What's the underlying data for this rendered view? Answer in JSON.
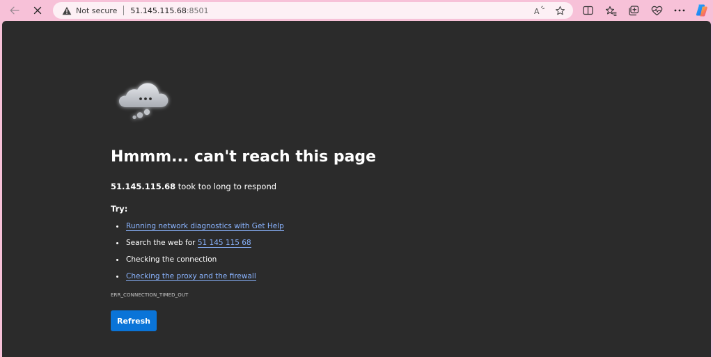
{
  "browser": {
    "address_bar": {
      "security_label": "Not secure",
      "url_host": "51.145.115.68",
      "url_port": ":8501"
    },
    "toolbar_icons": {
      "back": "back-arrow-icon",
      "stop": "close-icon",
      "read_aloud": "read-aloud-icon",
      "favorite": "star-icon",
      "split_screen": "split-screen-icon",
      "favorites": "favorites-icon",
      "collections": "collections-icon",
      "browser_essentials": "heart-pulse-icon",
      "menu": "more-icon",
      "copilot": "copilot-icon"
    }
  },
  "error_page": {
    "title": "Hmmm... can't reach this page",
    "subtitle_host": "51.145.115.68",
    "subtitle_rest": " took too long to respond",
    "try_label": "Try:",
    "suggestions": [
      {
        "text": "Running network diagnostics with Get Help"
      },
      {
        "prefix": "Search the web for ",
        "link": "51 145 115 68"
      },
      {
        "text": "Checking the connection"
      },
      {
        "text": "Checking the proxy and the firewall"
      }
    ],
    "error_code": "ERR_CONNECTION_TIMED_OUT",
    "refresh_label": "Refresh"
  },
  "colors": {
    "frame": "#f7c1d8",
    "page_background": "#2b2b2b",
    "link": "#8ab4ff",
    "button": "#0a74d8"
  }
}
